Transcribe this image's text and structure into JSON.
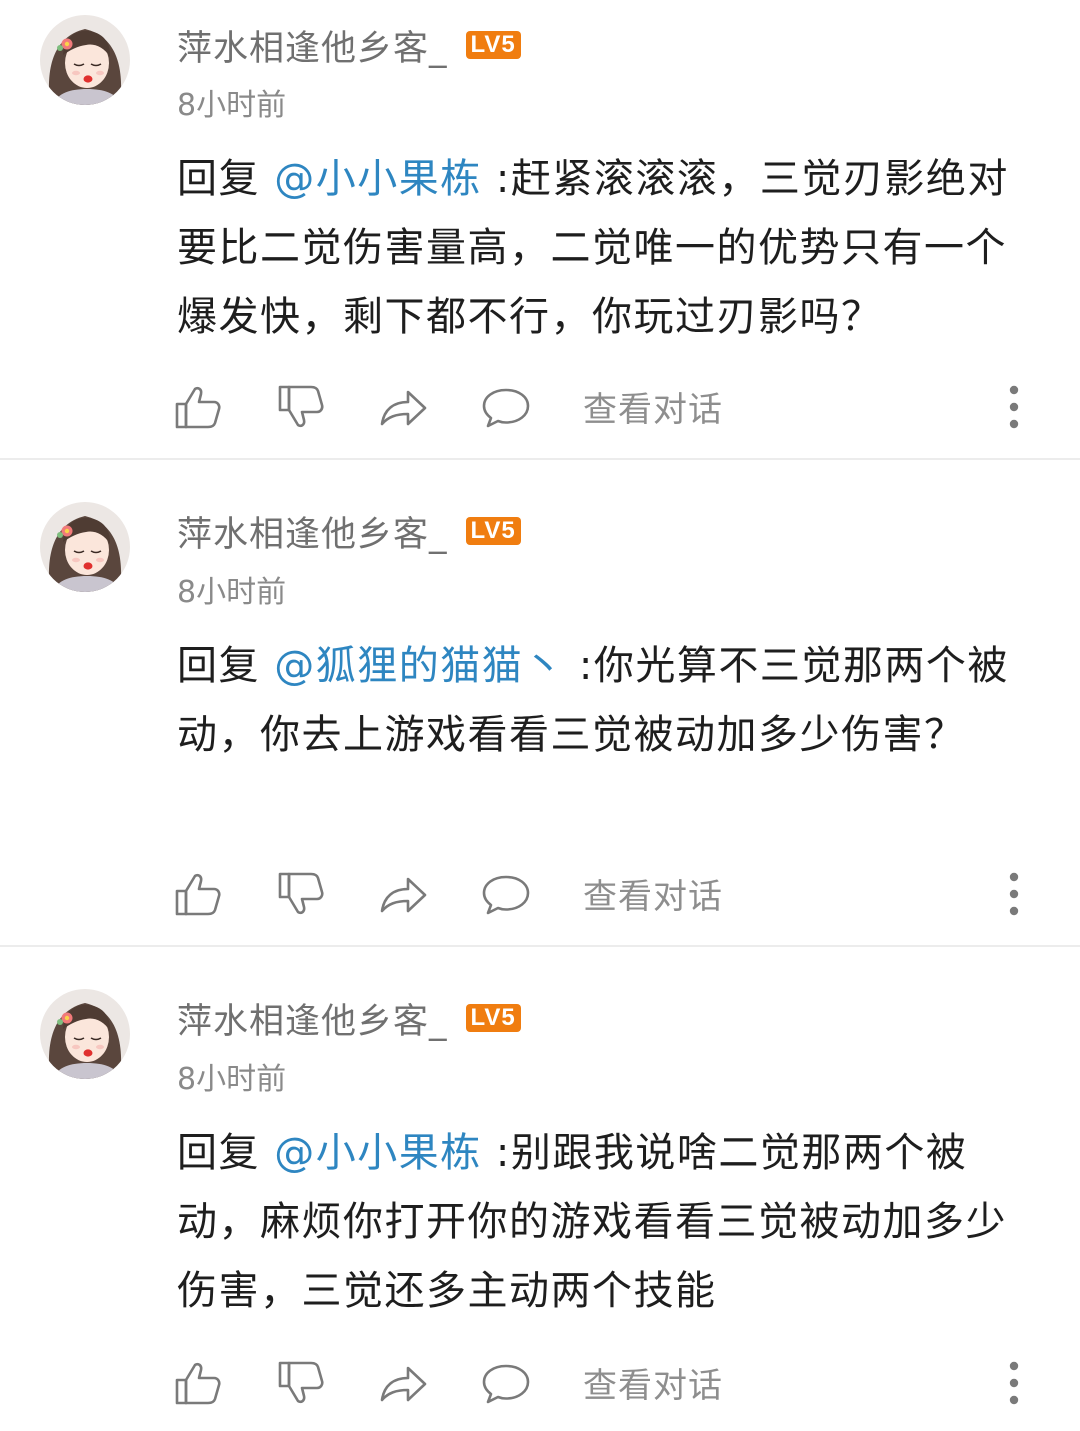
{
  "comments": [
    {
      "username": "萍水相逢他乡客_",
      "level": "LV5",
      "time": "8小时前",
      "reply_prefix": "回复 ",
      "mention": "@小小果栋",
      "text": " :赶紧滚滚滚，三觉刃影绝对要比二觉伤害量高，二觉唯一的优势只有一个爆发快，剩下都不行，你玩过刃影吗？",
      "view_conversation": "查看对话"
    },
    {
      "username": "萍水相逢他乡客_",
      "level": "LV5",
      "time": "8小时前",
      "reply_prefix": "回复 ",
      "mention": "@狐狸的猫猫丶",
      "text": " :你光算不三觉那两个被动，你去上游戏看看三觉被动加多少伤害？",
      "view_conversation": "查看对话"
    },
    {
      "username": "萍水相逢他乡客_",
      "level": "LV5",
      "time": "8小时前",
      "reply_prefix": "回复 ",
      "mention": "@小小果栋",
      "text": " :别跟我说啥二觉那两个被动，麻烦你打开你的游戏看看三觉被动加多少伤害，三觉还多主动两个技能",
      "view_conversation": "查看对话"
    }
  ],
  "icons": {
    "like": "thumbs-up-icon",
    "dislike": "thumbs-down-icon",
    "share": "share-arrow-icon",
    "reply": "speech-bubble-icon",
    "more": "vertical-ellipsis-icon"
  },
  "colors": {
    "mention": "#2e86c1",
    "level_badge": "#f07d10",
    "username": "#707070",
    "meta": "#8a8a8a",
    "body": "#1e1e1e",
    "divider": "#ececec"
  }
}
